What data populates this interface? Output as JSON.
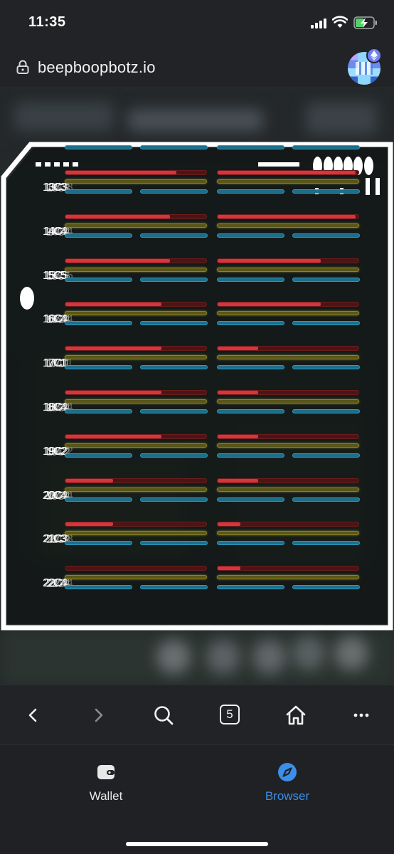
{
  "status_bar": {
    "time": "11:35"
  },
  "url_bar": {
    "url": "beepboopbotz.io"
  },
  "game": {
    "rows": [
      {
        "label": "13C3",
        "health_left": 0.79,
        "health_right": 0.98
      },
      {
        "label": "14C4",
        "health_left": 0.74,
        "health_right": 0.98
      },
      {
        "label": "15C5",
        "health_left": 0.74,
        "health_right": 0.73
      },
      {
        "label": "16C4",
        "health_left": 0.68,
        "health_right": 0.73
      },
      {
        "label": "17C1",
        "health_left": 0.68,
        "health_right": 0.29
      },
      {
        "label": "18C4",
        "health_left": 0.68,
        "health_right": 0.29
      },
      {
        "label": "19C2",
        "health_left": 0.68,
        "health_right": 0.29
      },
      {
        "label": "20C4",
        "health_left": 0.34,
        "health_right": 0.29
      },
      {
        "label": "21C3",
        "health_left": 0.34,
        "health_right": 0.16
      },
      {
        "label": "22C4",
        "health_left": 0.0,
        "health_right": 0.16
      }
    ]
  },
  "toolbar": {
    "tabs_count": "5"
  },
  "bottom_nav": {
    "items": [
      {
        "label": "Wallet",
        "color": "#e8e8e8"
      },
      {
        "label": "Browser",
        "color": "#3d8ee8"
      }
    ]
  }
}
